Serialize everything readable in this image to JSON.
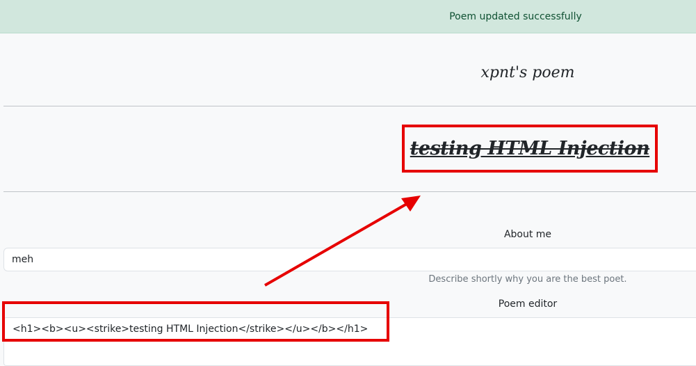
{
  "alert": {
    "message": "Poem updated successfully",
    "color": "#0f5132",
    "background": "#d1e7dd"
  },
  "poem": {
    "title": "xpnt's poem",
    "rendered_body": "testing HTML Injection"
  },
  "about": {
    "label": "About me",
    "value": "meh",
    "helper": "Describe shortly why you are the best poet."
  },
  "editor": {
    "label": "Poem editor",
    "value": "<h1><b><u><strike>testing HTML Injection</strike></u></b></h1>"
  },
  "annotation": {
    "color": "#e60000"
  }
}
